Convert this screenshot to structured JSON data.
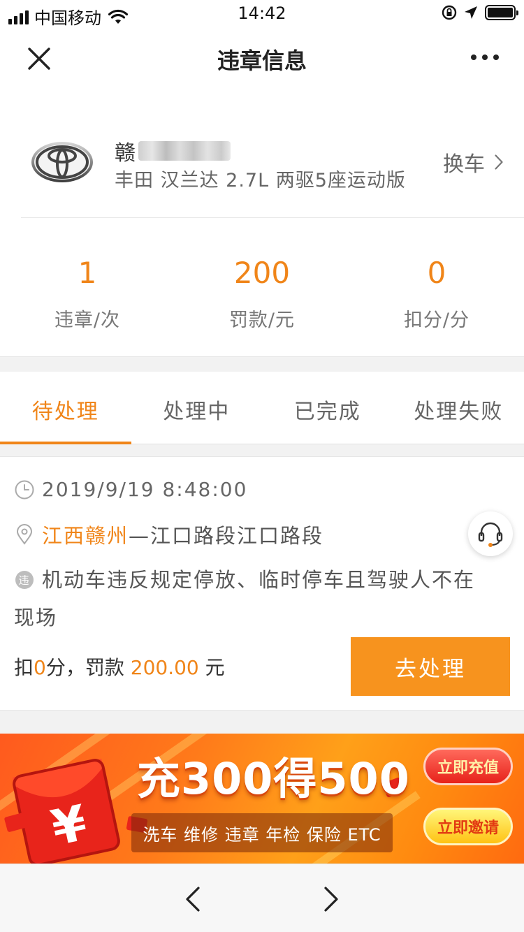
{
  "status_bar": {
    "carrier": "中国移动",
    "time": "14:42",
    "battery_level": 1.0
  },
  "nav": {
    "title": "违章信息",
    "close_icon": "close-icon",
    "more_icon": "more-icon"
  },
  "car": {
    "brand_icon": "toyota-logo",
    "plate_prefix": "赣",
    "model": "丰田 汉兰达 2.7L 两驱5座运动版",
    "switch_label": "换车"
  },
  "stats": [
    {
      "value": "1",
      "label": "违章/次"
    },
    {
      "value": "200",
      "label": "罚款/元"
    },
    {
      "value": "0",
      "label": "扣分/分"
    }
  ],
  "tabs": [
    {
      "label": "待处理",
      "active": true
    },
    {
      "label": "处理中",
      "active": false
    },
    {
      "label": "已完成",
      "active": false
    },
    {
      "label": "处理失败",
      "active": false
    }
  ],
  "violation": {
    "time": "2019/9/19 8:48:00",
    "location_city": "江西赣州",
    "location_detail": "—江口路段江口路段",
    "badge_char": "违",
    "description_line1": "机动车违反规定停放、临时停车且驾驶人不在",
    "description_line2": "现场",
    "penalty_points_prefix": "扣",
    "penalty_points": "0",
    "penalty_points_suffix": "分，罚款",
    "penalty_fine": "200.00",
    "penalty_fine_suffix": " 元",
    "action_label": "去处理"
  },
  "banner": {
    "headline": "充300得500",
    "tags": "洗车 维修 违章 年检 保险 ETC",
    "recharge_label": "立即充值",
    "invite_label": "立即邀请",
    "yen_symbol": "¥"
  },
  "toolbar": {
    "back_icon": "chevron-left-icon",
    "forward_icon": "chevron-right-icon"
  },
  "colors": {
    "accent": "#f08519",
    "button": "#f7931e",
    "divider_bg": "#f2f2f2"
  }
}
